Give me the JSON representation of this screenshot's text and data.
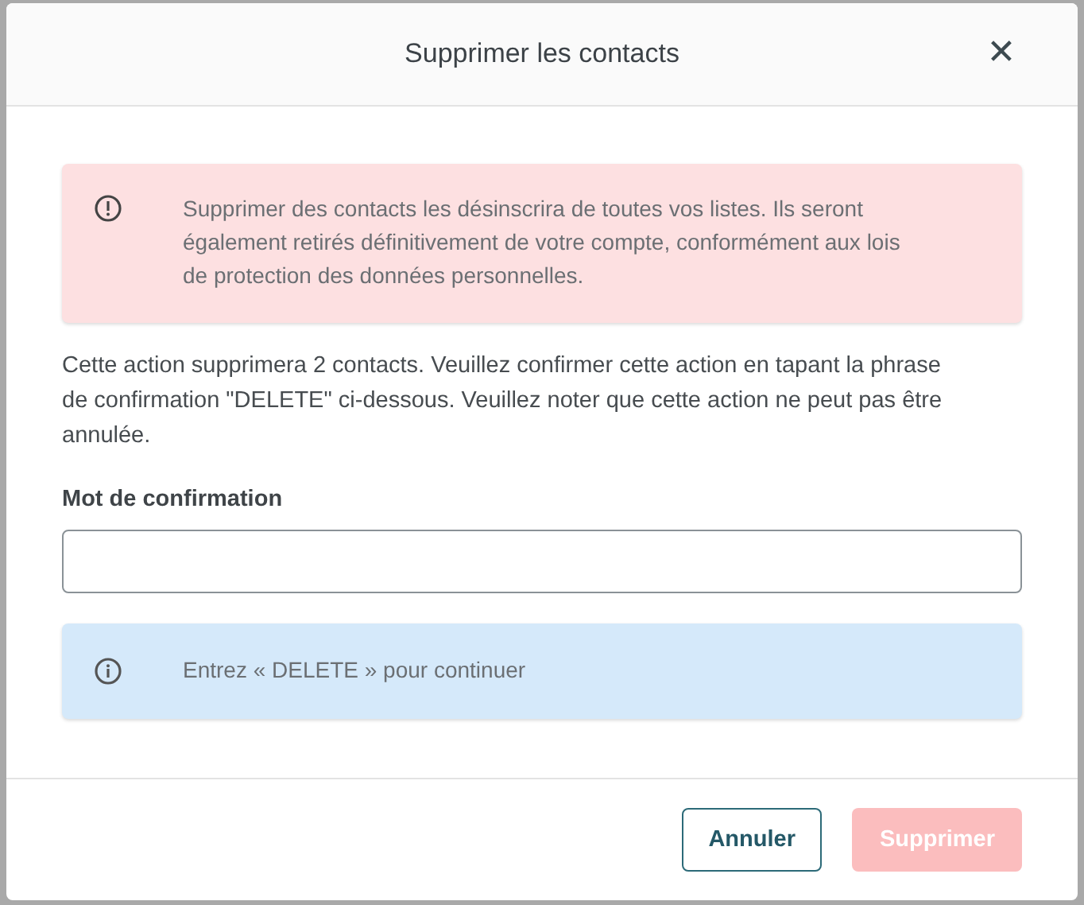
{
  "dialog": {
    "title": "Supprimer les contacts",
    "close_label": "✕"
  },
  "warning": {
    "text": "Supprimer des contacts les désinscrira de toutes vos listes. Ils seront également retirés définitivement de votre compte, conformément aux lois de protection des données personnelles."
  },
  "description": "Cette action supprimera 2 contacts. Veuillez confirmer cette action en tapant la phrase de confirmation \"DELETE\" ci-dessous. Veuillez noter que cette action ne peut pas être annulée.",
  "field": {
    "label": "Mot de confirmation"
  },
  "info": {
    "text": "Entrez « DELETE » pour continuer"
  },
  "buttons": [
    {
      "label": "Annuler",
      "kind": "secondary",
      "disabled": false
    },
    {
      "label": "Supprimer",
      "kind": "danger",
      "disabled": true
    }
  ]
}
